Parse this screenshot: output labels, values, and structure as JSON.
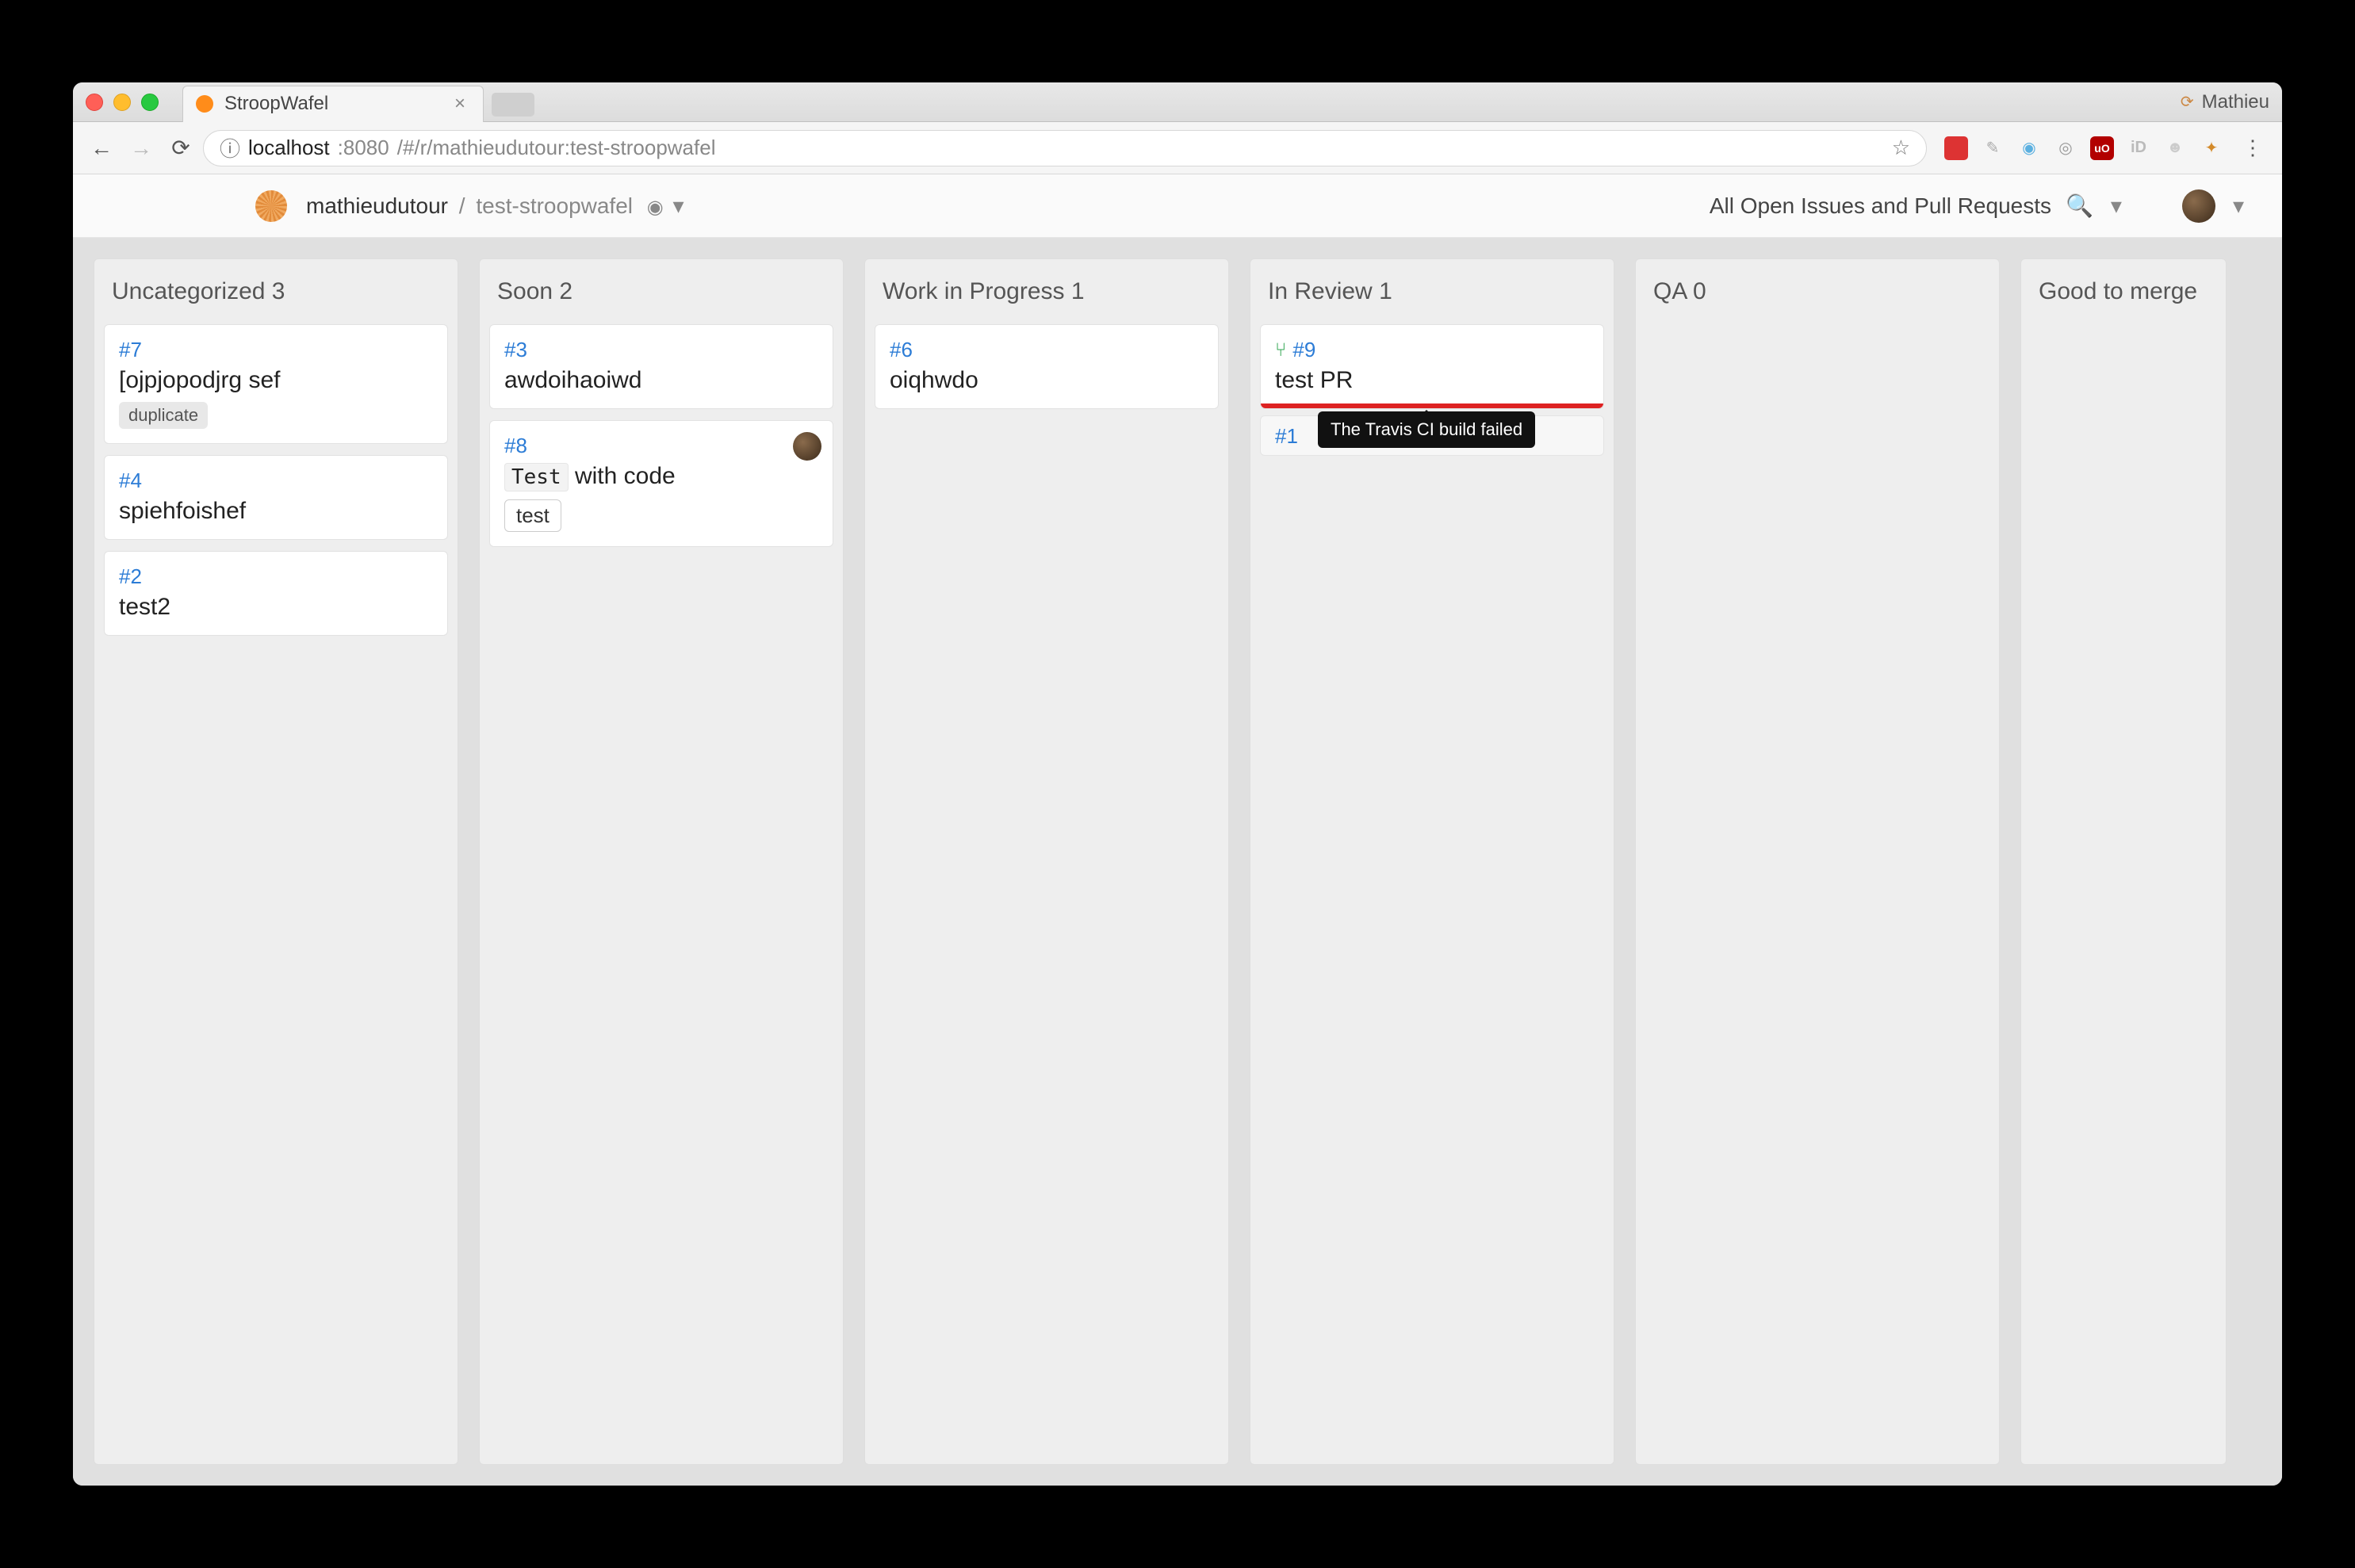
{
  "window": {
    "tab_title": "StroopWafel",
    "profile_name": "Mathieu"
  },
  "addressbar": {
    "host": "localhost",
    "port": ":8080",
    "path": "/#/r/mathieudutour:test-stroopwafel"
  },
  "header": {
    "owner": "mathieudutour",
    "separator": "/",
    "repo": "test-stroopwafel",
    "filter_label": "All Open Issues and Pull Requests"
  },
  "columns": [
    {
      "title": "Uncategorized",
      "count": "3",
      "cards": [
        {
          "num": "#7",
          "title": "[ojpjopodjrg sef",
          "labels": [
            "duplicate"
          ]
        },
        {
          "num": "#4",
          "title": "spiehfoishef"
        },
        {
          "num": "#2",
          "title": "test2"
        }
      ]
    },
    {
      "title": "Soon",
      "count": "2",
      "cards": [
        {
          "num": "#3",
          "title": "awdoihaoiwd"
        },
        {
          "num": "#8",
          "title_code": "Test",
          "title_rest": " with code",
          "outline_labels": [
            "test"
          ],
          "has_assignee": true
        }
      ]
    },
    {
      "title": "Work in Progress",
      "count": "1",
      "cards": [
        {
          "num": "#6",
          "title": "oiqhwdo"
        }
      ]
    },
    {
      "title": "In Review",
      "count": "1",
      "cards": [
        {
          "num": "#9",
          "title": "test PR",
          "is_pr": true,
          "status": "fail"
        }
      ],
      "peek": {
        "num": "#1",
        "tooltip": "The Travis CI build failed"
      }
    },
    {
      "title": "QA",
      "count": "0",
      "cards": []
    },
    {
      "title": "Good to merge",
      "count": "",
      "cards": []
    }
  ]
}
